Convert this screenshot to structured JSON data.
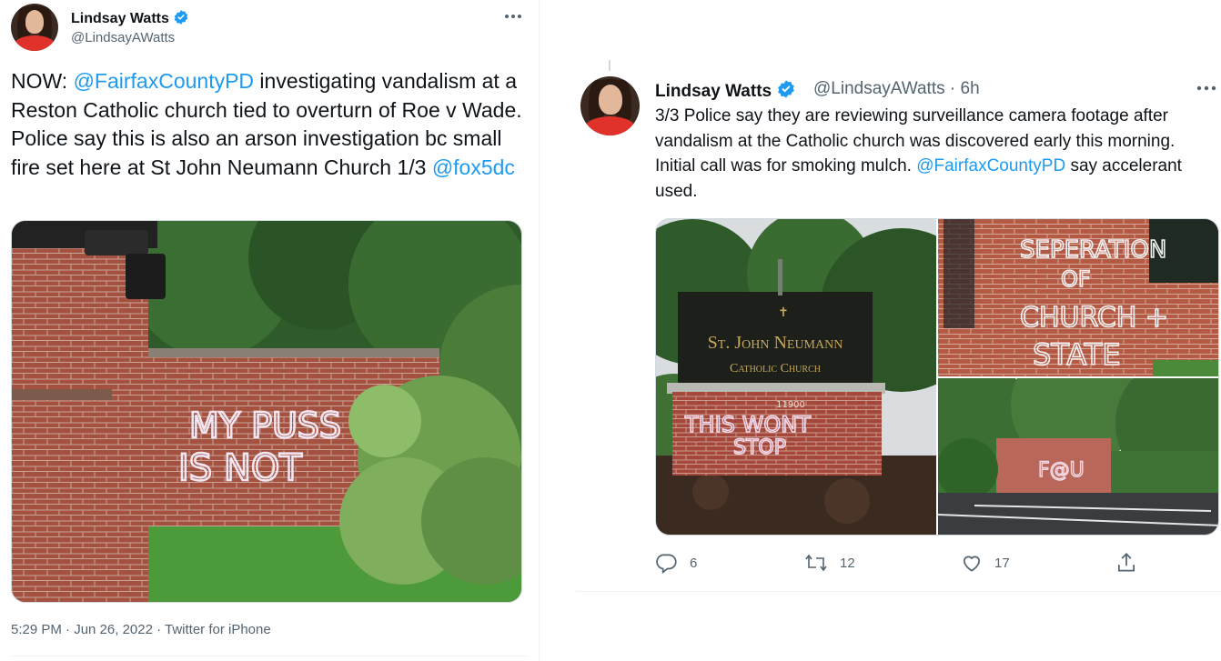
{
  "left_tweet": {
    "author_name": "Lindsay Watts",
    "author_handle": "@LindsayAWatts",
    "text_parts": [
      {
        "t": "NOW: ",
        "link": false
      },
      {
        "t": "@FairfaxCountyPD",
        "link": true
      },
      {
        "t": " investigating vandalism at a Reston Catholic church tied to overturn of Roe v Wade. Police say this is also an arson investigation bc small fire set here at St John Neumann Church 1/3 ",
        "link": false
      },
      {
        "t": "@fox5dc",
        "link": true
      }
    ],
    "media_graffiti": [
      "MY PUSS",
      "IS NOT"
    ],
    "timestamp": "5:29 PM · Jun 26, 2022 · Twitter for iPhone",
    "more_icon": "more-dots-icon"
  },
  "right_tweet": {
    "author_name": "Lindsay Watts",
    "author_handle": "@LindsayAWatts",
    "time_ago": "· 6h",
    "text_parts": [
      {
        "t": "3/3 Police say they are reviewing surveillance camera footage after vandalism at the Catholic church was discovered early this morning. Initial call was for smoking mulch. ",
        "link": false
      },
      {
        "t": "@FairfaxCountyPD",
        "link": true
      },
      {
        "t": " say accelerant used.",
        "link": false
      }
    ],
    "media": {
      "sign_line1": "St. John Neumann",
      "sign_line2": "Catholic Church",
      "sign_address": "11900",
      "graffiti_sign": [
        "THIS WONT",
        "STOP"
      ],
      "graffiti_wall": [
        "SEPERATION",
        "OF",
        "CHURCH +",
        "STATE"
      ],
      "graffiti_lot": "F@U"
    },
    "actions": {
      "reply_count": "6",
      "retweet_count": "12",
      "like_count": "17"
    },
    "colors": {
      "link": "#1d9bf0",
      "verified": "#1d9bf0",
      "muted": "#536471"
    }
  }
}
